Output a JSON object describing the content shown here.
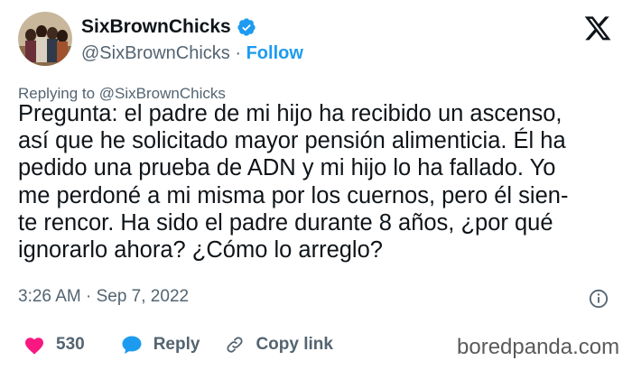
{
  "author": {
    "name": "SixBrownChicks",
    "handle": "@SixBrownChicks",
    "separator": "·",
    "follow_label": "Follow",
    "verified_icon": "verified-badge-icon",
    "avatar": "group-photo-avatar"
  },
  "platform_logo": "x-logo-icon",
  "reply_context": "Replying to @SixBrownChicks",
  "tweet_lines": [
    "Pregunta: el padre de mi hijo ha recibido un ascenso,",
    "así que he solicitado mayor pensión alimenticia. Él ha",
    "pedido una prueba de ADN y mi hijo lo ha fallado. Yo",
    "me perdoné a mi misma por los cuernos, pero él sien-",
    "te rencor. Ha sido el padre durante 8 años, ¿por qué",
    "ignorarlo ahora? ¿Cómo lo arreglo?"
  ],
  "timestamp": "3:26 AM · Sep 7, 2022",
  "actions": {
    "like_count": "530",
    "reply_label": "Reply",
    "copy_link_label": "Copy link"
  },
  "watermark": "boredpanda.com",
  "colors": {
    "accent": "#1d9bf0",
    "like": "#f91880",
    "text": "#0f1419",
    "secondary": "#536471"
  }
}
